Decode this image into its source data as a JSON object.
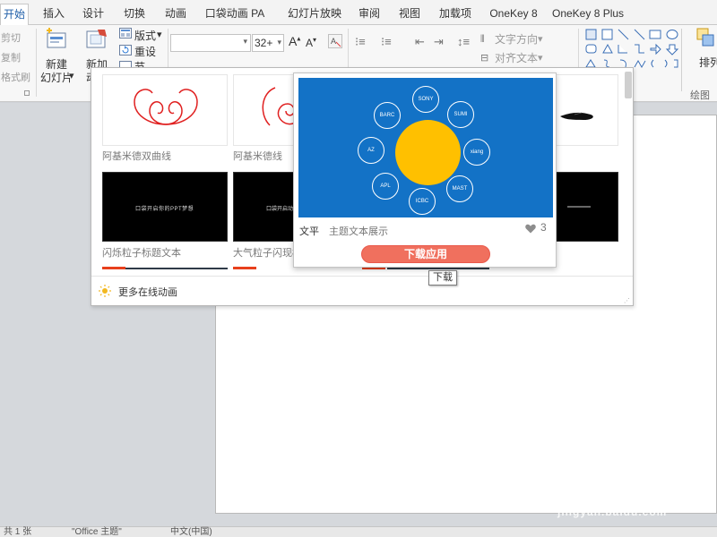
{
  "tabs": [
    "开始",
    "插入",
    "设计",
    "切换",
    "动画",
    "口袋动画 PA",
    "幻灯片放映",
    "审阅",
    "视图",
    "加载项",
    "OneKey 8",
    "OneKey 8 Plus"
  ],
  "ribbon": {
    "clipboard": {
      "cut": "剪切",
      "copy": "复制",
      "format_painter": "格式刷"
    },
    "slides": {
      "new_slide_line1": "新建",
      "new_slide_line2": "幻灯片",
      "new_anim_line1": "新加",
      "new_anim_line2": "动画",
      "layout": "版式",
      "reset": "重设",
      "section": "节"
    },
    "font": {
      "size": "32+"
    },
    "paragraph": {
      "text_direction": "文字方向",
      "align_text": "对齐文本"
    },
    "drawing": {
      "arrange": "排列",
      "group_label": "绘图"
    }
  },
  "gallery": {
    "items": [
      {
        "caption": "阿基米德双曲线"
      },
      {
        "caption": "阿基米德线"
      },
      {
        "caption": "闪烁粒子标题文本"
      },
      {
        "caption": "大气粒子闪现标"
      }
    ],
    "dark_thumb_text_1": "口袋开启你的PPT梦想",
    "dark_thumb_text_2": "口袋开启动画",
    "more_link": "更多在线动画"
  },
  "preview_card": {
    "bubbles": [
      "SONY",
      "SUMI",
      "xiang",
      "MAST",
      "ICBC",
      "APL",
      "AZ",
      "BARC"
    ],
    "tag": "文平",
    "title": "主题文本展示",
    "likes": "3",
    "download_button": "下载应用",
    "tooltip": "下载"
  },
  "statusbar": {
    "slide_info": "共 1 张",
    "theme": "\"Office 主题\"",
    "lang": "中文(中国)"
  },
  "watermark": {
    "brand": "Baidu 经验",
    "url": "jingyan.baidu.com"
  }
}
